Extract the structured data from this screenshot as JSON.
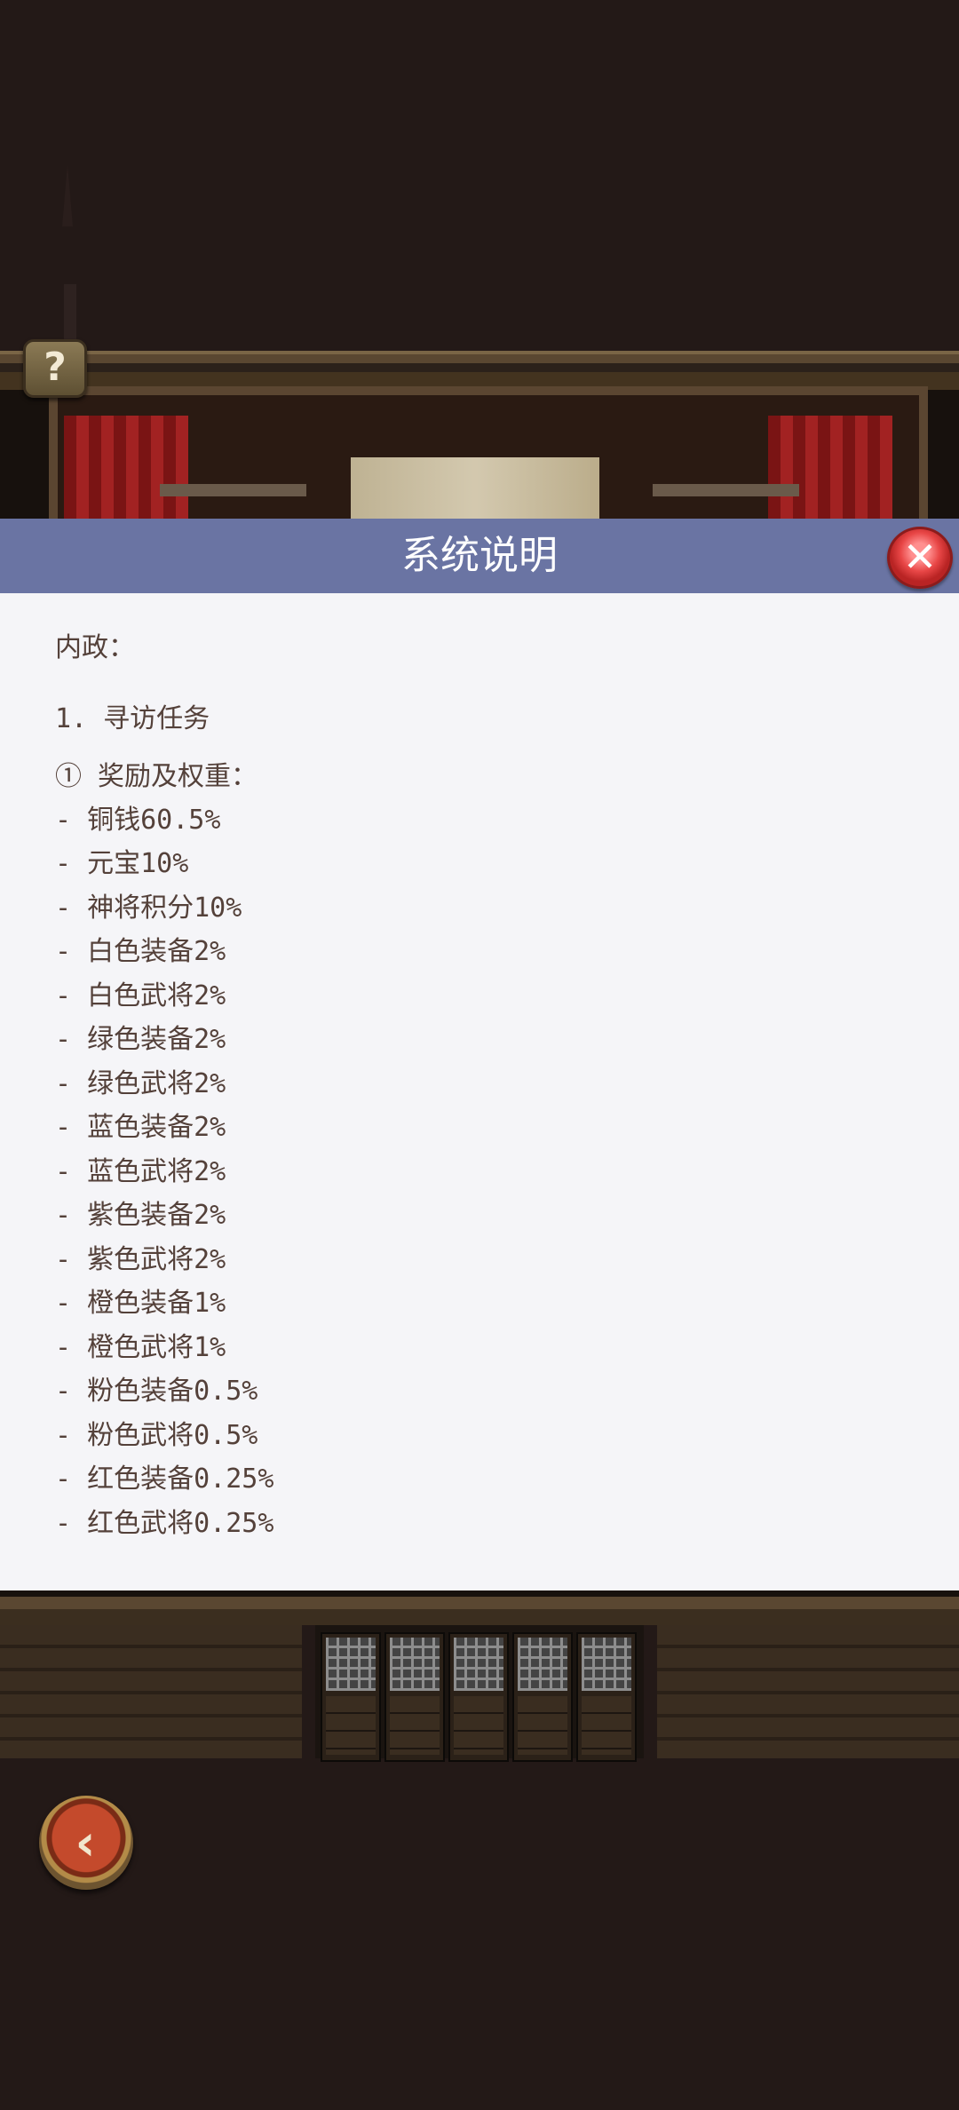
{
  "background": {
    "help_icon": "question-mark-icon",
    "help_label": "?",
    "back_icon": "back-arrow-icon",
    "back_label": "‹"
  },
  "modal": {
    "title": "系统说明",
    "close_icon": "close-icon",
    "close_label": "✕",
    "section_title": "内政：",
    "task_heading": "1. 寻访任务",
    "rewards_heading": "① 奖励及权重：",
    "rewards": [
      "- 铜钱60.5%",
      "- 元宝10%",
      "- 神将积分10%",
      "- 白色装备2%",
      "- 白色武将2%",
      "- 绿色装备2%",
      "- 绿色武将2%",
      "- 蓝色装备2%",
      "- 蓝色武将2%",
      "- 紫色装备2%",
      "- 紫色武将2%",
      "- 橙色装备1%",
      "- 橙色武将1%",
      "- 粉色装备0.5%",
      "- 粉色武将0.5%",
      "- 红色装备0.25%",
      "- 红色武将0.25%"
    ]
  },
  "colors": {
    "header": "#6a74a3",
    "text": "#54413a",
    "background": "#231917"
  }
}
